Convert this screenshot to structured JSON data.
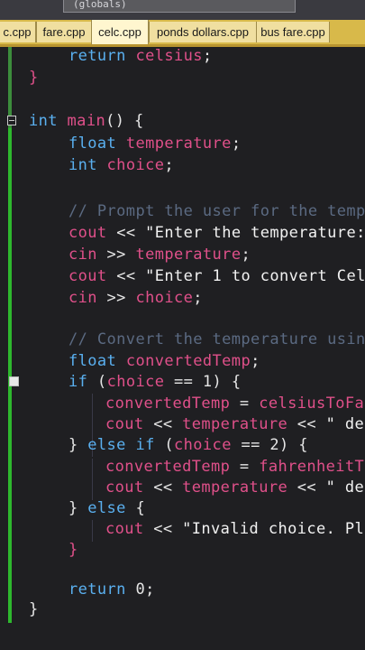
{
  "scope_selector": "(globals)",
  "tabs": [
    {
      "label": "c.cpp",
      "active": false
    },
    {
      "label": "fare.cpp",
      "active": false
    },
    {
      "label": "celc.cpp",
      "active": true
    },
    {
      "label": "ponds dollars.cpp",
      "active": false
    },
    {
      "label": "bus fare.cpp",
      "active": false
    }
  ],
  "code_lines": [
    "return celsius;",
    "}",
    "int main() {",
    "float temperature;",
    "int choice;",
    "// Prompt the user for the temp",
    "cout << \"Enter the temperature:",
    "cin >> temperature;",
    "cout << \"Enter 1 to convert Cel",
    "cin >> choice;",
    "// Convert the temperature usin",
    "float convertedTemp;",
    "if (choice == 1) {",
    "convertedTemp = celsiusToFa",
    "cout << temperature << \" de",
    "} else if (choice == 2) {",
    "convertedTemp = fahrenheitT",
    "cout << temperature << \" deg",
    "} else {",
    "cout << \"Invalid choice. Ple",
    "}",
    "return 0;",
    "}"
  ],
  "colors": {
    "background": "#1f1f22",
    "keyword": "#5ab0f0",
    "identifier": "#e0508a",
    "comment": "#5b6a82",
    "string": "#f2f2f2",
    "tabbar": "#d8b94a",
    "change_bar": "#2eb82e"
  }
}
